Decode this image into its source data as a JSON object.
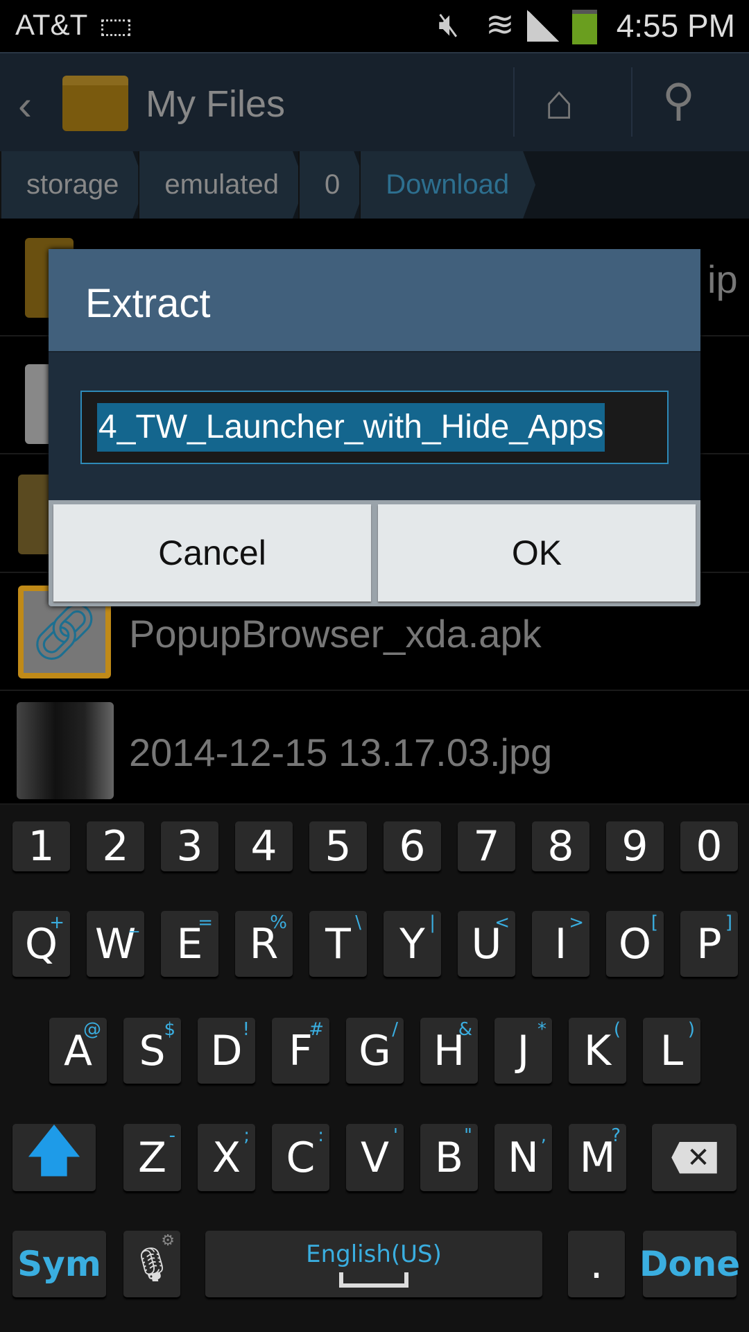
{
  "status": {
    "carrier": "AT&T",
    "time": "4:55 PM",
    "battery_color": "#6a9e1f",
    "icons": [
      "keyboard-icon",
      "mute-icon",
      "wifi-icon",
      "signal-icon",
      "battery-icon"
    ]
  },
  "actionbar": {
    "title": "My Files"
  },
  "breadcrumb": [
    "storage",
    "emulated",
    "0",
    "Download"
  ],
  "files": [
    {
      "name": "ip"
    },
    {
      "name": ""
    },
    {
      "name": ""
    },
    {
      "name": "PopupBrowser_xda.apk"
    },
    {
      "name": "2014-12-15 13.17.03.jpg"
    }
  ],
  "dialog": {
    "title": "Extract",
    "input_value": "4_TW_Launcher_with_Hide_Apps",
    "cancel": "Cancel",
    "ok": "OK"
  },
  "keyboard": {
    "numbers": [
      "1",
      "2",
      "3",
      "4",
      "5",
      "6",
      "7",
      "8",
      "9",
      "0"
    ],
    "row1": [
      [
        "Q",
        "+"
      ],
      [
        "W",
        "_"
      ],
      [
        "E",
        "="
      ],
      [
        "R",
        "%"
      ],
      [
        "T",
        "\\"
      ],
      [
        "Y",
        "|"
      ],
      [
        "U",
        "<"
      ],
      [
        "I",
        ">"
      ],
      [
        "O",
        "["
      ],
      [
        "P",
        "]"
      ]
    ],
    "row2": [
      [
        "A",
        "@"
      ],
      [
        "S",
        "$"
      ],
      [
        "D",
        "!"
      ],
      [
        "F",
        "#"
      ],
      [
        "G",
        "/"
      ],
      [
        "H",
        "&"
      ],
      [
        "J",
        "*"
      ],
      [
        "K",
        "("
      ],
      [
        "L",
        ")"
      ]
    ],
    "row3": [
      [
        "Z",
        "-"
      ],
      [
        "X",
        ";"
      ],
      [
        "C",
        ":"
      ],
      [
        "V",
        "'"
      ],
      [
        "B",
        "\""
      ],
      [
        "N",
        ","
      ],
      [
        "M",
        "?"
      ]
    ],
    "sym": "Sym",
    "space_label": "English(US)",
    "period": ".",
    "done": "Done",
    "accent": "#3aaee0"
  }
}
